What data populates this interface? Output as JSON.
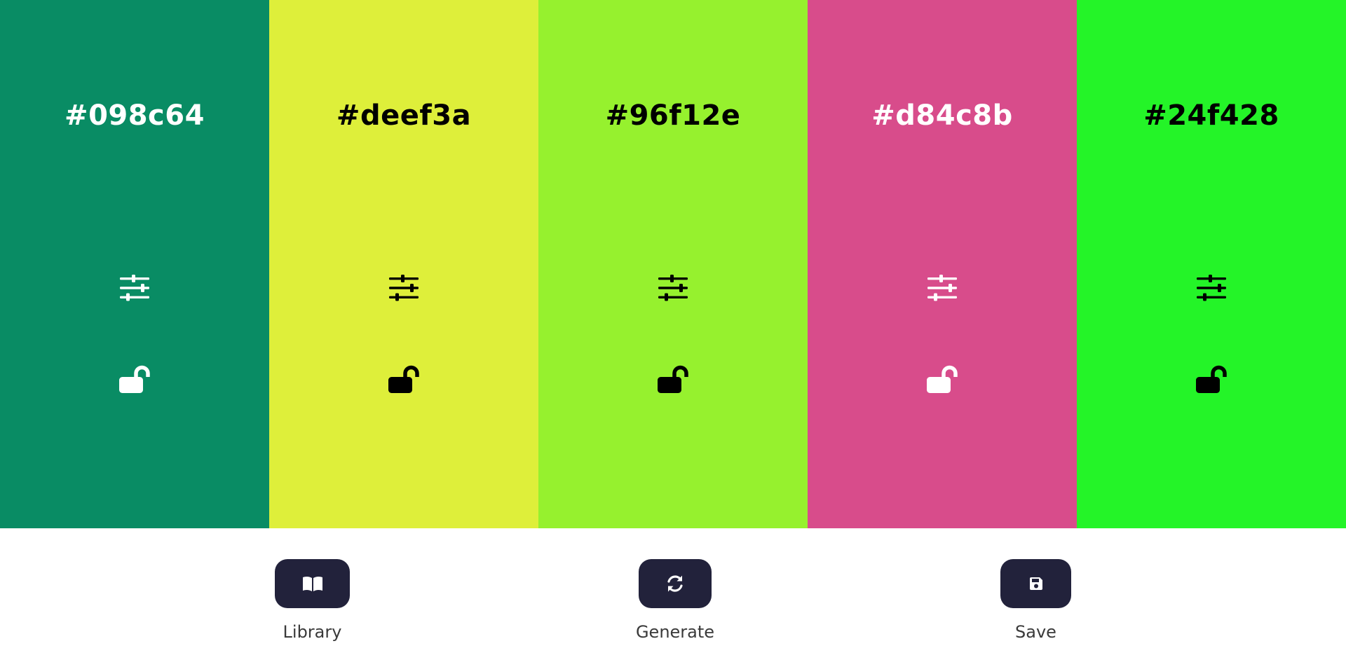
{
  "palette": {
    "colors": [
      {
        "hex": "#098c64",
        "text_color": "#ffffff",
        "adjust_icon": "sliders-icon",
        "lock_icon": "lock-open-icon",
        "locked": false
      },
      {
        "hex": "#deef3a",
        "text_color": "#000000",
        "adjust_icon": "sliders-icon",
        "lock_icon": "lock-open-icon",
        "locked": false
      },
      {
        "hex": "#96f12e",
        "text_color": "#000000",
        "adjust_icon": "sliders-icon",
        "lock_icon": "lock-open-icon",
        "locked": false
      },
      {
        "hex": "#d84c8b",
        "text_color": "#ffffff",
        "adjust_icon": "sliders-icon",
        "lock_icon": "lock-open-icon",
        "locked": false
      },
      {
        "hex": "#24f428",
        "text_color": "#000000",
        "adjust_icon": "sliders-icon",
        "lock_icon": "lock-open-icon",
        "locked": false
      }
    ]
  },
  "controls": {
    "library": {
      "label": "Library",
      "icon": "book-open-icon"
    },
    "generate": {
      "label": "Generate",
      "icon": "refresh-icon"
    },
    "save": {
      "label": "Save",
      "icon": "floppy-disk-icon"
    }
  },
  "theme": {
    "button_bg": "#22223b",
    "label_color": "#3a3a3a",
    "background": "#ffffff"
  }
}
